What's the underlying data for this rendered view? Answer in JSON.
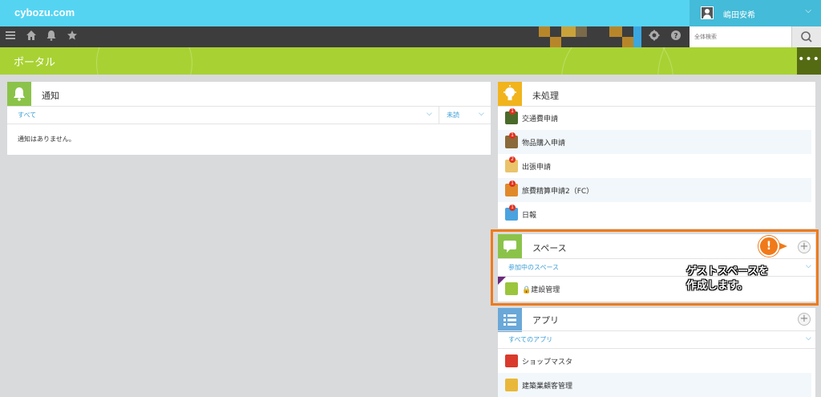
{
  "header": {
    "logo": "cybozu.com",
    "user_name": "嶋田安希",
    "chevron": "⌵"
  },
  "toolbar": {
    "icons": [
      "menu-icon",
      "home-icon",
      "bell-icon",
      "star-icon",
      "gear-icon",
      "help-icon",
      "search-icon"
    ],
    "search_placeholder": "全体検索"
  },
  "portal": {
    "title": "ポータル",
    "menu": "•••"
  },
  "notifications": {
    "title": "通知",
    "filter_left": "すべて",
    "filter_right": "未読",
    "empty_message": "通知はありません。"
  },
  "pending": {
    "title": "未処理",
    "items": [
      {
        "label": "交通費申請",
        "badge": "1",
        "icon": "train-icon",
        "color": "#4a6b2a"
      },
      {
        "label": "物品購入申請",
        "badge": "1",
        "icon": "calculator-icon",
        "color": "#8a6a3a"
      },
      {
        "label": "出張申請",
        "badge": "2",
        "icon": "map-icon",
        "color": "#e9c46a"
      },
      {
        "label": "旅費精算申請2（FC）",
        "badge": "1",
        "icon": "bus-icon",
        "color": "#e0892b"
      },
      {
        "label": "日報",
        "badge": "1",
        "icon": "list-icon",
        "color": "#4aa3df"
      }
    ]
  },
  "spaces": {
    "title": "スペース",
    "filter": "参加中のスペース",
    "items": [
      {
        "label": "🔒建設管理",
        "icon": "space-thumbnail-icon"
      }
    ]
  },
  "apps": {
    "title": "アプリ",
    "filter": "すべてのアプリ",
    "items": [
      {
        "label": "ショップマスタ",
        "icon": "shop-icon",
        "color": "#d93a2b"
      },
      {
        "label": "建築業顧客管理",
        "icon": "person-icon",
        "color": "#e9b83a"
      }
    ]
  },
  "callout": {
    "marker": "!",
    "line1": "ゲストスペースを",
    "line2": "作成します。"
  },
  "colors": {
    "header": "#55d4f2",
    "toolbar": "#3d3d3d",
    "portal": "#a8d233",
    "highlight": "#f07a1a",
    "link": "#3a9ed6"
  }
}
